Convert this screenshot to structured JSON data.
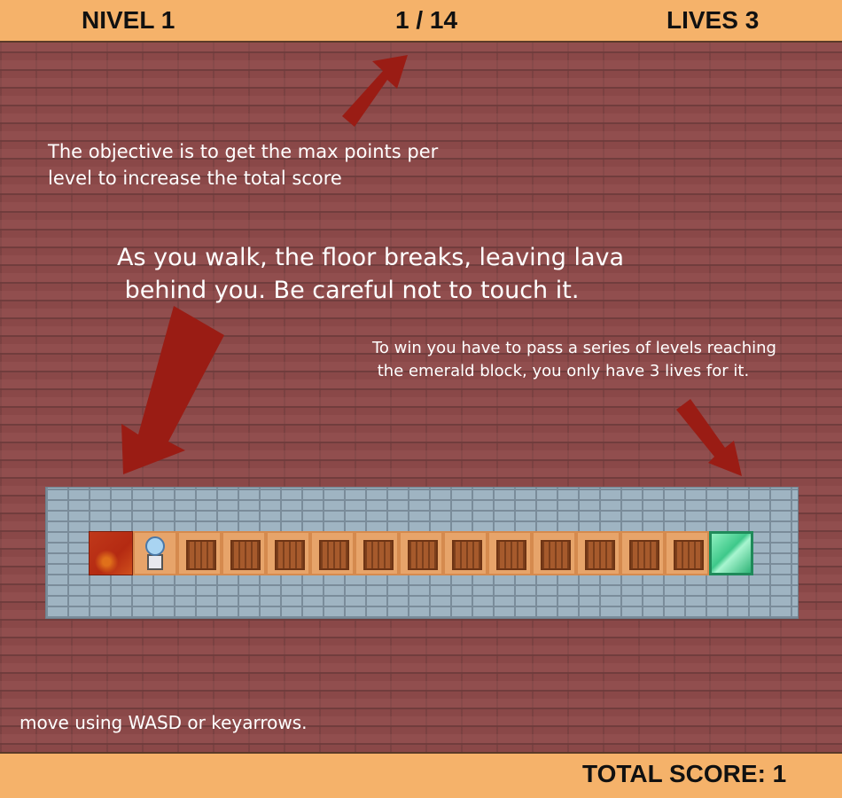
{
  "hud": {
    "level": "NIVEL 1",
    "progress": "1 / 14",
    "lives": "LIVES 3",
    "total_score": "TOTAL SCORE: 1"
  },
  "tips": {
    "objective": "The objective is to get the max points per\nlevel to increase the total score",
    "lava": "As you walk, the floor breaks, leaving lava\n behind you. Be careful not to touch it.",
    "win": "To win you have to pass a series of levels reaching\n the emerald block, you only have 3 lives for it.",
    "move": "move using WASD or keyarrows."
  },
  "board": {
    "tiles": [
      "lava",
      "player",
      "crate",
      "crate",
      "crate",
      "crate",
      "crate",
      "crate",
      "crate",
      "crate",
      "crate",
      "crate",
      "crate",
      "crate",
      "emerald"
    ]
  },
  "colors": {
    "hud_bar": "#f5b26a",
    "brick_wall": "#8a4848",
    "arrow": "#9a1c14",
    "lava": "#c0381a",
    "emerald": "#3ec88a",
    "stone": "#9fb4c2"
  }
}
